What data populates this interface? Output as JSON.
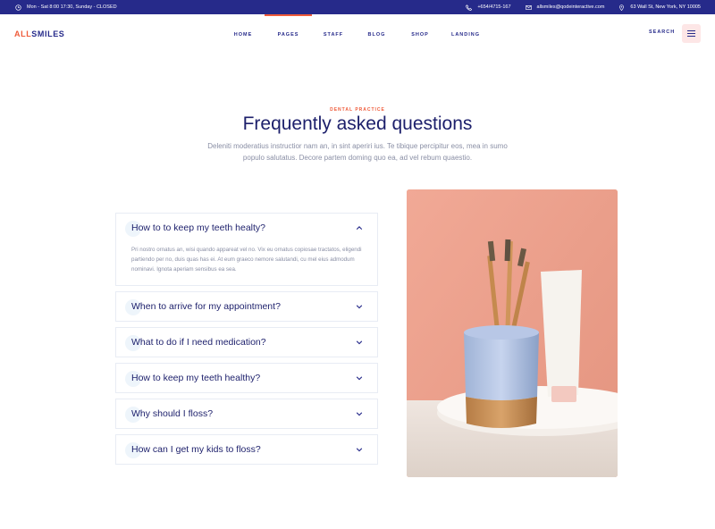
{
  "topbar": {
    "hours": "Mon - Sat 8:00 17:30, Sunday - CLOSED",
    "phone": "+654/4715-167",
    "email": "allsmiles@qodeinteractive.com",
    "address": "63 Wall St, New York, NY 10005"
  },
  "header": {
    "logo_part1": "ALL",
    "logo_part2": "SMILES",
    "nav": [
      {
        "label": "HOME"
      },
      {
        "label": "PAGES"
      },
      {
        "label": "STAFF"
      },
      {
        "label": "BLOG"
      },
      {
        "label": "SHOP"
      },
      {
        "label": "LANDING"
      }
    ],
    "search_label": "SEARCH",
    "menu_icon": "hamburger-icon"
  },
  "section": {
    "eyebrow": "DENTAL PRACTICE",
    "title": "Frequently asked questions",
    "subtitle": "Deleniti moderatius instructior nam an, in sint aperiri ius. Te tibique percipitur eos, mea in sumo populo salutatus. Decore partem doming quo ea, ad vel rebum quaestio."
  },
  "faq": [
    {
      "question": "How to to keep my teeth healty?",
      "answer": "Pri nostro ornatus an, wisi quando appareat vel no. Vix eu ornatus copiosae tractatos, eligendi partiendo per no, duis quas has ei. At eum graeco nemore salutandi, cu mel eius admodum nominavi. Ignota aperiam sensibus ea sea.",
      "open": true
    },
    {
      "question": "When to arrive for my appointment?",
      "open": false
    },
    {
      "question": "What to do if I need medication?",
      "open": false
    },
    {
      "question": "How to keep my teeth healthy?",
      "open": false
    },
    {
      "question": "Why should I floss?",
      "open": false
    },
    {
      "question": "How can I get my kids to floss?",
      "open": false
    }
  ],
  "colors": {
    "brand_navy": "#262a8a",
    "accent_orange": "#ef5b3a",
    "text_muted": "#8a8fa5"
  }
}
